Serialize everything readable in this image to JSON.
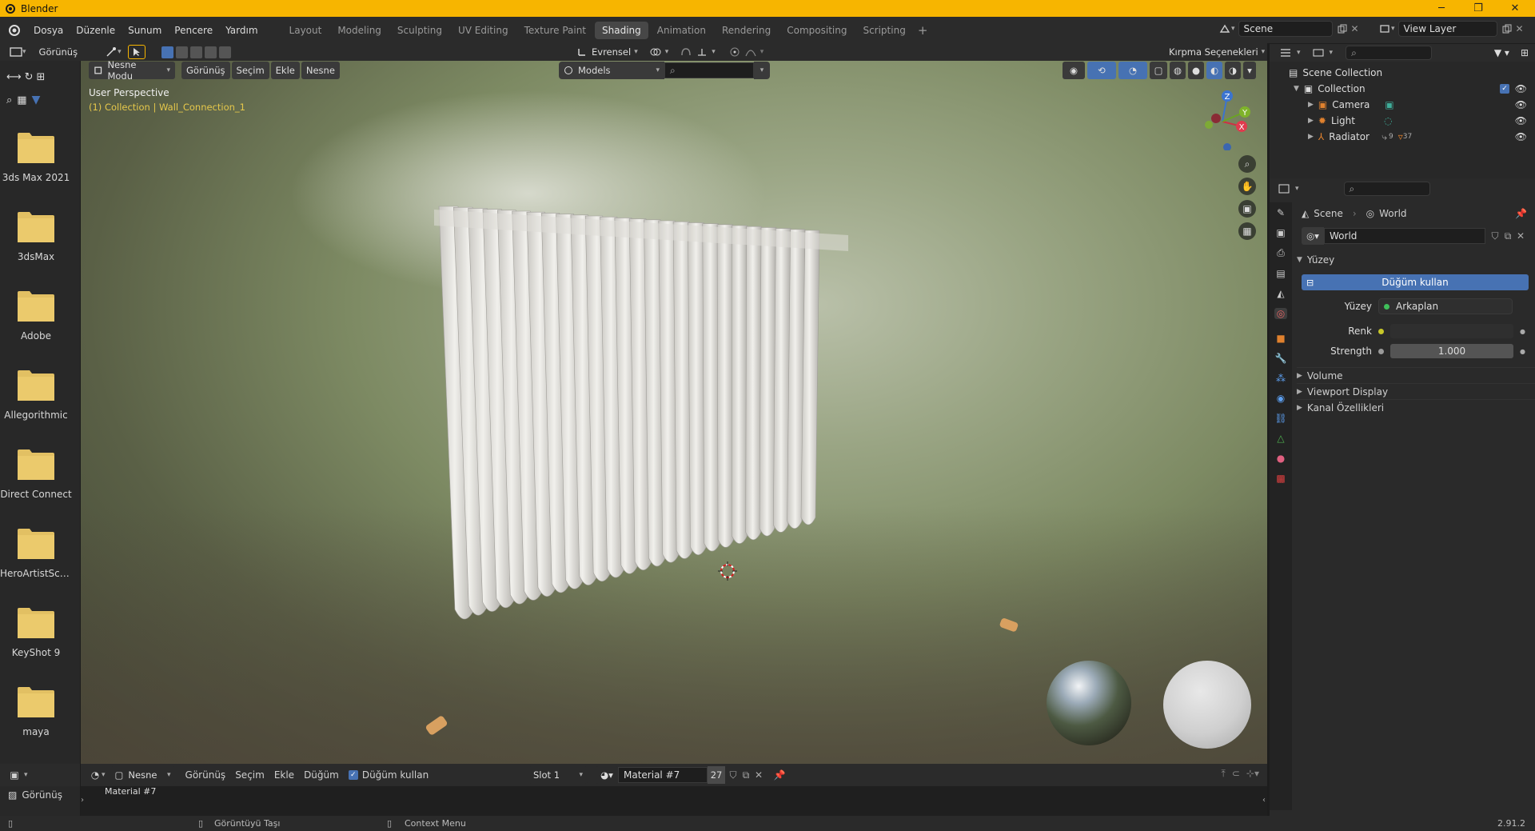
{
  "window": {
    "title": "Blender",
    "controls": {
      "minimize": "─",
      "maximize": "❐",
      "close": "✕"
    }
  },
  "menubar": {
    "items": [
      "Dosya",
      "Düzenle",
      "Sunum",
      "Pencere",
      "Yardım"
    ]
  },
  "workspace_tabs": [
    "Layout",
    "Modeling",
    "Sculpting",
    "UV Editing",
    "Texture Paint",
    "Shading",
    "Animation",
    "Rendering",
    "Compositing",
    "Scripting"
  ],
  "active_tab": "Shading",
  "scene_field": "Scene",
  "view_layer_field": "View Layer",
  "filebrowser": {
    "header_label": "Görünüş",
    "folders": [
      "3ds Max 2021",
      "3dsMax",
      "Adobe",
      "Allegorithmic",
      "Direct Connect",
      "HeroArtistScr...",
      "KeyShot 9",
      "maya"
    ]
  },
  "viewport": {
    "transform_orientation": "Evrensel",
    "clipping_label": "Kırpma Seçenekleri",
    "mode": "Nesne Modu",
    "menu": [
      "Görünüş",
      "Seçim",
      "Ekle",
      "Nesne"
    ],
    "collection_dropdown": "Models",
    "perspective": "User Perspective",
    "collection_info": "(1) Collection | Wall_Connection_1"
  },
  "outliner": {
    "root": "Scene Collection",
    "collection": "Collection",
    "items": [
      "Camera",
      "Light",
      "Radiator"
    ],
    "radiator_counts": [
      "9",
      "37"
    ]
  },
  "properties": {
    "breadcrumb_scene": "Scene",
    "breadcrumb_world": "World",
    "world_name": "World",
    "surface_panel": "Yüzey",
    "use_nodes_btn": "Düğüm kullan",
    "surface_label": "Yüzey",
    "surface_value": "Arkaplan",
    "color_label": "Renk",
    "strength_label": "Strength",
    "strength_value": "1.000",
    "collapsed_panels": [
      "Volume",
      "Viewport Display",
      "Kanal Özellikleri"
    ]
  },
  "node_editor": {
    "mode": "Nesne",
    "menu": [
      "Görünüş",
      "Seçim",
      "Ekle",
      "Düğüm"
    ],
    "use_nodes": "Düğüm kullan",
    "slot": "Slot 1",
    "material": "Material #7",
    "users": "27",
    "material_label": "Material #7",
    "left_header": "Görünüş"
  },
  "statusbar": {
    "left_hint": "Görüntüyü Taşı",
    "middle_hint": "Context Menu",
    "version": "2.91.2"
  },
  "colors": {
    "title_bar": "#f7b500",
    "accent": "#4772b3"
  }
}
